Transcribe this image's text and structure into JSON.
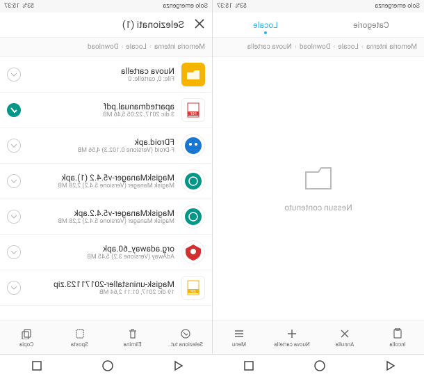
{
  "status": {
    "carrier": "Solo emergenza",
    "time": "15:37",
    "battery": "53%"
  },
  "tabs": {
    "locale": "Locale",
    "categorie": "Categorie"
  },
  "selection": {
    "title": "Selezionati (1)"
  },
  "breadcrumbs": {
    "left": [
      "Memoria interna",
      "Locale",
      "Download",
      "Nuova cartella"
    ],
    "right": [
      "Memoria interna",
      "Locale",
      "Download"
    ]
  },
  "empty": {
    "label": "Nessun contenuto"
  },
  "files": [
    {
      "name": "Nuova cartella",
      "meta": "File: 0, cartelle: 0",
      "icon": "folder",
      "checked": false
    },
    {
      "name": "apartedmanual.pdf",
      "meta": "3 dic 2017, 22:05 5,46 MB",
      "icon": "pdf",
      "checked": true
    },
    {
      "name": "FDroid.apk",
      "meta": "F-Droid (Versione 0.102.3) 4,56 MB",
      "icon": "apk-fdroid",
      "checked": false
    },
    {
      "name": "MagiskManager-v5.4.2 (1).apk",
      "meta": "Magisk Manager (Versione 5.4.2) 2,28 MB",
      "icon": "apk-magisk",
      "checked": false
    },
    {
      "name": "MagiskManager-v5.4.2.apk",
      "meta": "Magisk Manager (Versione 5.4.2) 2,28 MB",
      "icon": "apk-magisk",
      "checked": false
    },
    {
      "name": "org.adaway_60.apk",
      "meta": "AdAway (Versione 3.2) 5,45 MB",
      "icon": "apk-adaway",
      "checked": false
    },
    {
      "name": "Magisk-uninstaller-20171123.zip",
      "meta": "19 dic 2017, 01:11 2,64 MB",
      "icon": "zip",
      "checked": false
    }
  ],
  "toolbar": {
    "left": [
      {
        "label": "Incolla",
        "icon": "paste"
      },
      {
        "label": "Annulla",
        "icon": "cancel"
      },
      {
        "label": "Nuova cartella",
        "icon": "newfolder"
      },
      {
        "label": "Menu",
        "icon": "menu"
      }
    ],
    "right": [
      {
        "label": "Seleziona tut..",
        "icon": "selectall"
      },
      {
        "label": "Elimina",
        "icon": "delete"
      },
      {
        "label": "Sposta",
        "icon": "move"
      },
      {
        "label": "Copia",
        "icon": "copy"
      }
    ]
  }
}
